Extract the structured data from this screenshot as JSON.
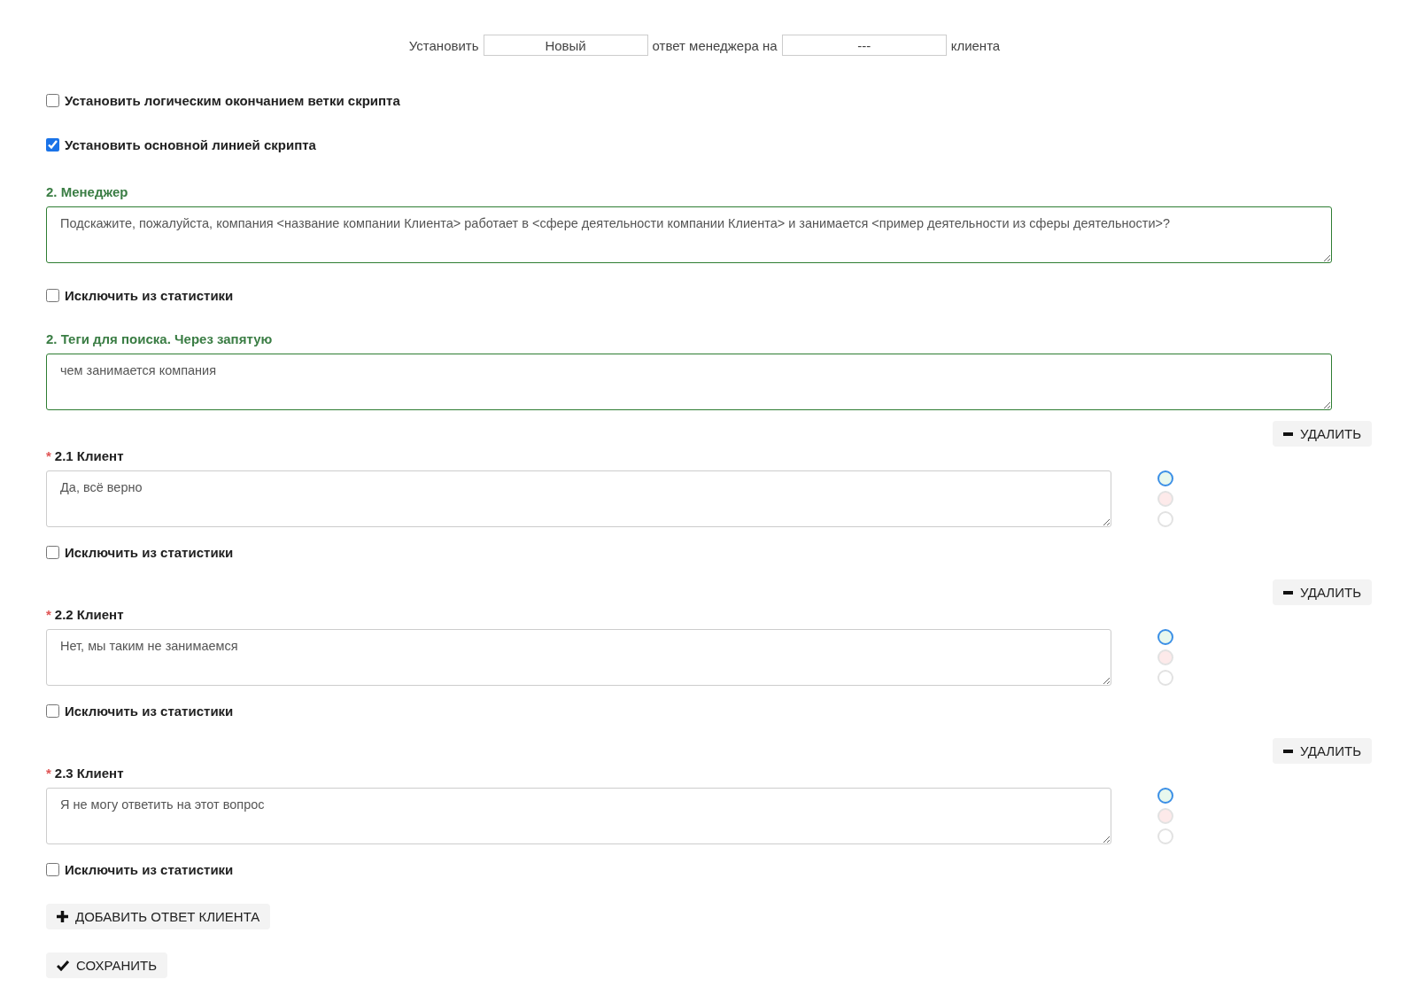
{
  "status_line": {
    "prefix": "Установить",
    "status_value": "Новый",
    "middle": "ответ менеджера на",
    "target_value": "---",
    "suffix": "клиента"
  },
  "options": [
    {
      "label": "Установить логическим окончанием ветки скрипта",
      "checked": false
    },
    {
      "label": "Установить основной линией скрипта",
      "checked": true
    }
  ],
  "manager": {
    "label": "2. Менеджер",
    "text": "Подскажите, пожалуйста, компания <название компании Клиента> работает в <сфере деятельности компании Клиента> и занимается <пример деятельности из сферы деятельности>?",
    "exclude_label": "Исключить из статистики",
    "exclude_checked": false
  },
  "tags": {
    "label": "2. Теги для поиска. Через запятую",
    "text": "чем занимается компания"
  },
  "answers": [
    {
      "label": "2.1 Клиент",
      "required_mark": "*",
      "delete_label": "УДАЛИТЬ",
      "text": "Да, всё верно",
      "exclude_label": "Исключить из статистики",
      "exclude_checked": false,
      "ratings": [
        {
          "color": "#e8f8ee",
          "selected": true
        },
        {
          "color": "#fdeaea",
          "selected": false
        },
        {
          "color": "#ffffff",
          "selected": false
        }
      ]
    },
    {
      "label": "2.2 Клиент",
      "required_mark": "*",
      "delete_label": "УДАЛИТЬ",
      "text": "Нет, мы таким не занимаемся",
      "exclude_label": "Исключить из статистики",
      "exclude_checked": false,
      "ratings": [
        {
          "color": "#e8f8ee",
          "selected": true
        },
        {
          "color": "#fdeaea",
          "selected": false
        },
        {
          "color": "#ffffff",
          "selected": false
        }
      ]
    },
    {
      "label": "2.3 Клиент",
      "required_mark": "*",
      "delete_label": "УДАЛИТЬ",
      "text": "Я не могу ответить на этот вопрос",
      "exclude_label": "Исключить из статистики",
      "exclude_checked": false,
      "ratings": [
        {
          "color": "#e8f8ee",
          "selected": true
        },
        {
          "color": "#fdeaea",
          "selected": false
        },
        {
          "color": "#ffffff",
          "selected": false
        }
      ]
    }
  ],
  "add_button": "ДОБАВИТЬ ОТВЕТ КЛИЕНТА",
  "save_button": "СОХРАНИТЬ"
}
